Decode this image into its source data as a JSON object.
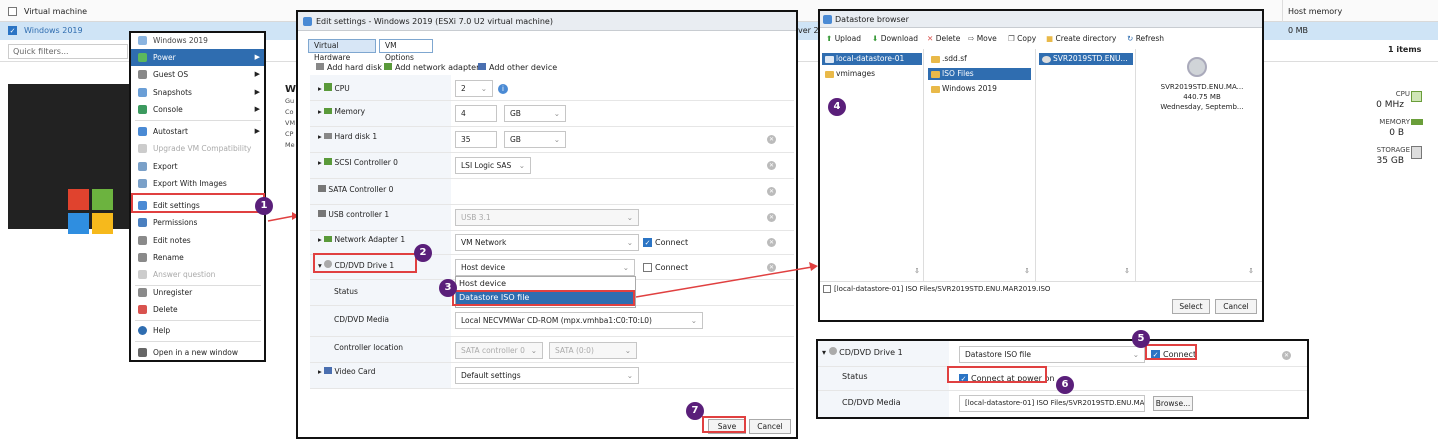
{
  "background": {
    "header_col1": "Virtual machine",
    "header_col2": "Host memory",
    "selected_vm": "Windows 2019",
    "row_fragment": "ver 20",
    "row_memory": "0 MB",
    "filter_placeholder": "Quick filters...",
    "items_count": "1 items",
    "summary_title_fragment": "Wi",
    "summary_lines": [
      "Gu",
      "Co",
      "VM",
      "CP",
      "Me"
    ],
    "stats": {
      "cpu_label": "CPU",
      "cpu_value": "0 MHz",
      "memory_label": "MEMORY",
      "memory_value": "0 B",
      "storage_label": "STORAGE",
      "storage_value": "35 GB"
    }
  },
  "context_menu": {
    "title": "Windows 2019",
    "items": [
      {
        "label": "Power",
        "icon": "power-icon",
        "submenu": true,
        "highlight": true
      },
      {
        "label": "Guest OS",
        "icon": "guest-os-icon",
        "submenu": true
      },
      {
        "label": "Snapshots",
        "icon": "snapshot-icon",
        "submenu": true
      },
      {
        "label": "Console",
        "icon": "console-icon",
        "submenu": true
      },
      {
        "label": "Autostart",
        "icon": "autostart-icon",
        "submenu": true
      },
      {
        "label": "Upgrade VM Compatibility",
        "icon": "upgrade-icon",
        "disabled": true
      },
      {
        "label": "Export",
        "icon": "export-icon"
      },
      {
        "label": "Export With Images",
        "icon": "export-images-icon"
      },
      {
        "label": "Edit settings",
        "icon": "edit-settings-icon"
      },
      {
        "label": "Permissions",
        "icon": "permissions-icon"
      },
      {
        "label": "Edit notes",
        "icon": "edit-notes-icon"
      },
      {
        "label": "Rename",
        "icon": "rename-icon"
      },
      {
        "label": "Answer question",
        "icon": "answer-icon",
        "disabled": true
      },
      {
        "label": "Unregister",
        "icon": "unregister-icon"
      },
      {
        "label": "Delete",
        "icon": "delete-icon"
      },
      {
        "label": "Help",
        "icon": "help-icon"
      },
      {
        "label": "Open in a new window",
        "icon": "new-window-icon"
      }
    ]
  },
  "edit_settings": {
    "title": "Edit settings - Windows 2019 (ESXi 7.0 U2 virtual machine)",
    "tabs": [
      "Virtual Hardware",
      "VM Options"
    ],
    "toolbar": [
      "Add hard disk",
      "Add network adapter",
      "Add other device"
    ],
    "cpu": {
      "label": "CPU",
      "value": "2"
    },
    "memory": {
      "label": "Memory",
      "value": "4",
      "unit": "GB"
    },
    "hard_disk": {
      "label": "Hard disk 1",
      "value": "35",
      "unit": "GB"
    },
    "scsi": {
      "label": "SCSI Controller 0",
      "value": "LSI Logic SAS"
    },
    "sata": {
      "label": "SATA Controller 0"
    },
    "usb": {
      "label": "USB controller 1",
      "value": "USB 3.1"
    },
    "network": {
      "label": "Network Adapter 1",
      "value": "VM Network",
      "connect": "Connect"
    },
    "cd": {
      "label": "CD/DVD Drive 1",
      "value": "Host device",
      "connect": "Connect",
      "options": [
        "Host device",
        "Datastore ISO file"
      ]
    },
    "status_label": "Status",
    "cd_media_label": "CD/DVD Media",
    "cd_media_value": "Local NECVMWar CD-ROM (mpx.vmhba1:C0:T0:L0)",
    "controller_label": "Controller location",
    "controller_value": "SATA controller 0",
    "controller_slot": "SATA (0:0)",
    "video": {
      "label": "Video Card",
      "value": "Default settings"
    },
    "save": "Save",
    "cancel": "Cancel"
  },
  "datastore_browser": {
    "title": "Datastore browser",
    "toolbar": [
      "Upload",
      "Download",
      "Delete",
      "Move",
      "Copy",
      "Create directory",
      "Refresh"
    ],
    "col1": [
      "local-datastore-01",
      "vmimages"
    ],
    "col2": [
      ".sdd.sf",
      "ISO Files",
      "Windows 2019"
    ],
    "col3": [
      "SVR2019STD.ENU..."
    ],
    "preview": {
      "name": "SVR2019STD.ENU.MA...",
      "size": "440.75 MB",
      "date": "Wednesday, Septemb..."
    },
    "path": "[local-datastore-01] ISO Files/SVR2019STD.ENU.MAR2019.ISO",
    "select": "Select",
    "cancel": "Cancel"
  },
  "cd_panel": {
    "label": "CD/DVD Drive 1",
    "value": "Datastore ISO file",
    "connect": "Connect",
    "status_label": "Status",
    "power_on": "Connect at power on",
    "media_label": "CD/DVD Media",
    "media_value": "[local-datastore-01] ISO Files/SVR2019STD.ENU.MAI",
    "browse": "Browse..."
  },
  "badges": [
    "1",
    "2",
    "3",
    "4",
    "5",
    "6",
    "7"
  ],
  "colors": {
    "accent": "#2f6db0",
    "highlight_box": "#e04040",
    "badge": "#5a1f7a"
  }
}
